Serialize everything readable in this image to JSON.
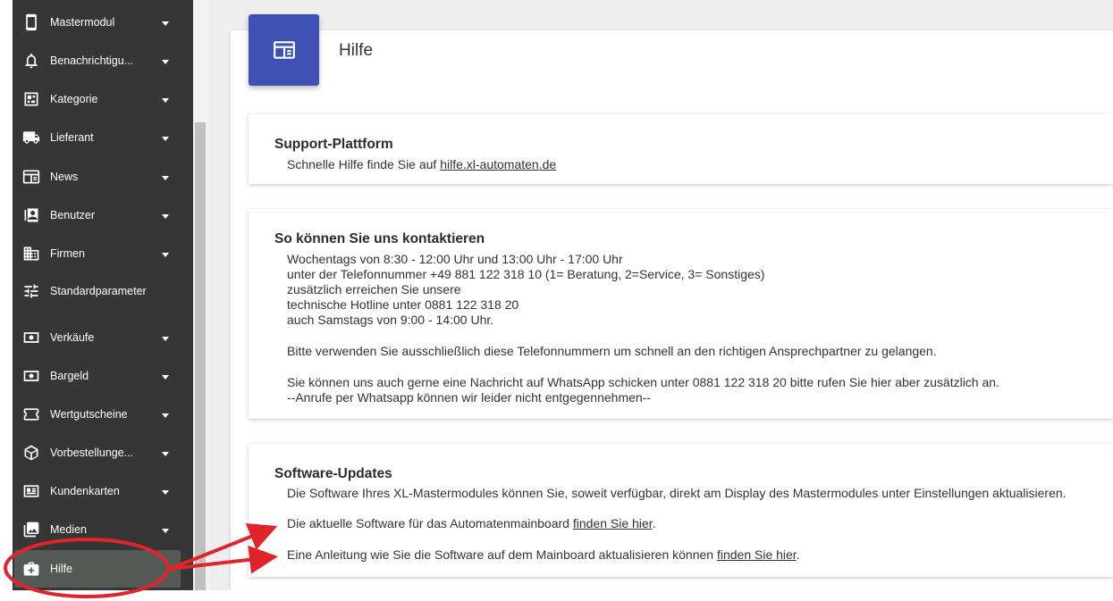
{
  "sidebar": {
    "items": [
      {
        "label": "Mastermodul",
        "icon": "tablet-icon",
        "has_caret": true
      },
      {
        "label": "Benachrichtigu...",
        "icon": "bell-icon",
        "has_caret": true
      },
      {
        "label": "Kategorie",
        "icon": "category-icon",
        "has_caret": true
      },
      {
        "label": "Lieferant",
        "icon": "truck-icon",
        "has_caret": true
      },
      {
        "label": "News",
        "icon": "news-icon",
        "has_caret": true
      },
      {
        "label": "Benutzer",
        "icon": "contacts-icon",
        "has_caret": true
      },
      {
        "label": "Firmen",
        "icon": "building-icon",
        "has_caret": true
      },
      {
        "label": "Standardparameter",
        "icon": "tune-icon",
        "has_caret": false
      },
      {
        "label": "Verkäufe",
        "icon": "cash-icon",
        "has_caret": true
      },
      {
        "label": "Bargeld",
        "icon": "money-icon",
        "has_caret": true
      },
      {
        "label": "Wertgutscheine",
        "icon": "ticket-icon",
        "has_caret": true
      },
      {
        "label": "Vorbestellunge...",
        "icon": "package-icon",
        "has_caret": true
      },
      {
        "label": "Kundenkarten",
        "icon": "id-card-icon",
        "has_caret": true
      },
      {
        "label": "Medien",
        "icon": "media-icon",
        "has_caret": true
      },
      {
        "label": "Hilfe",
        "icon": "medical-bag-icon",
        "has_caret": false,
        "active": true
      }
    ]
  },
  "header": {
    "title": "Hilfe",
    "icon": "news-icon",
    "icon_color": "#3f51b5"
  },
  "support": {
    "title": "Support-Plattform",
    "text": "Schnelle Hilfe finde Sie auf ",
    "link": "hilfe.xl-automaten.de"
  },
  "contact": {
    "title": "So können Sie uns kontaktieren",
    "lines": [
      "Wochentags von 8:30 - 12:00 Uhr und 13:00 Uhr - 17:00 Uhr",
      "unter der Telefonnummer +49 881 122 318 10 (1= Beratung, 2=Service, 3= Sonstiges)",
      "zusätzlich erreichen Sie unsere",
      "technische Hotline unter 0881 122 318 20",
      "auch Samstags von 9:00 - 14:00 Uhr.",
      "Bitte verwenden Sie ausschließlich diese Telefonnummern um schnell an den richtigen Ansprechpartner zu gelangen.",
      "Sie können uns auch gerne eine Nachricht auf WhatsApp schicken unter 0881 122 318 20 bitte rufen Sie hier aber zusätzlich an.",
      "--Anrufe per Whatsapp können wir leider nicht entgegennehmen--"
    ]
  },
  "updates": {
    "title": "Software-Updates",
    "intro": "Die Software Ihres XL-Mastermodules können Sie, soweit verfügbar, direkt am Display des Mastermodules unter Einstellungen aktualisieren.",
    "line1_text": "Die aktuelle Software für das Automatenmainboard ",
    "line1_link": "finden Sie hier",
    "line2_text": "Eine Anleitung wie Sie die Software auf dem Mainboard aktualisieren können ",
    "line2_link": "finden Sie hier",
    "period": "."
  },
  "colors": {
    "sidebar_bg": "#363636",
    "active_item_bg": "#555a57",
    "accent": "#3f51b5",
    "annotation": "#e0242c"
  }
}
